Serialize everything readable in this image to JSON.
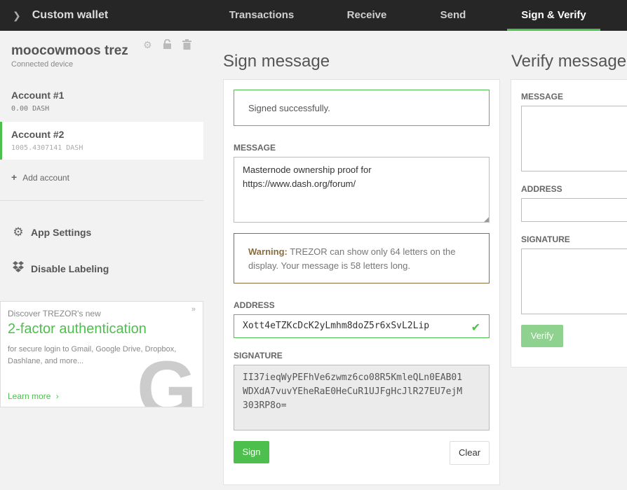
{
  "header": {
    "wallet_title": "Custom wallet",
    "tabs": [
      {
        "label": "Transactions"
      },
      {
        "label": "Receive"
      },
      {
        "label": "Send"
      },
      {
        "label": "Sign & Verify"
      }
    ]
  },
  "sidebar": {
    "device_name": "moocowmoos trez",
    "device_status": "Connected device",
    "accounts": [
      {
        "name": "Account #1",
        "balance": "0.00 DASH"
      },
      {
        "name": "Account #2",
        "balance": "1005.4307141 DASH"
      }
    ],
    "add_account": "Add account",
    "menu": [
      {
        "label": "App Settings"
      },
      {
        "label": "Disable Labeling"
      }
    ],
    "promo": {
      "intro": "Discover TREZOR's new",
      "headline": "2-factor authentication",
      "body": "for secure login to Gmail, Google Drive, Dropbox, Dashlane, and more...",
      "link": "Learn more",
      "logo_letter": "G",
      "close": "»"
    }
  },
  "sign": {
    "title": "Sign message",
    "success": "Signed successfully.",
    "message_label": "MESSAGE",
    "message_value": "Masternode ownership proof for\nhttps://www.dash.org/forum/",
    "warning_strong": "Warning:",
    "warning_text": " TREZOR can show only 64 letters on the display. Your message is 58 letters long.",
    "address_label": "ADDRESS",
    "address_value": "Xott4eTZKcDcK2yLmhm8doZ5r6xSvL2Lip",
    "signature_label": "SIGNATURE",
    "signature_value": "II37ieqWyPEFhVe6zwmz6co08R5KmleQLn0EAB01\nWDXdA7vuvYEheRaE0HeCuR1UJFgHcJlR27EU7ejM\n303RP8o=",
    "sign_button": "Sign",
    "clear_button": "Clear"
  },
  "verify": {
    "title": "Verify message",
    "message_label": "MESSAGE",
    "address_label": "ADDRESS",
    "signature_label": "SIGNATURE",
    "verify_button": "Verify"
  },
  "colors": {
    "accent": "#4cbf4c",
    "header_bg": "#262626",
    "warning": "#8a6d3b"
  }
}
